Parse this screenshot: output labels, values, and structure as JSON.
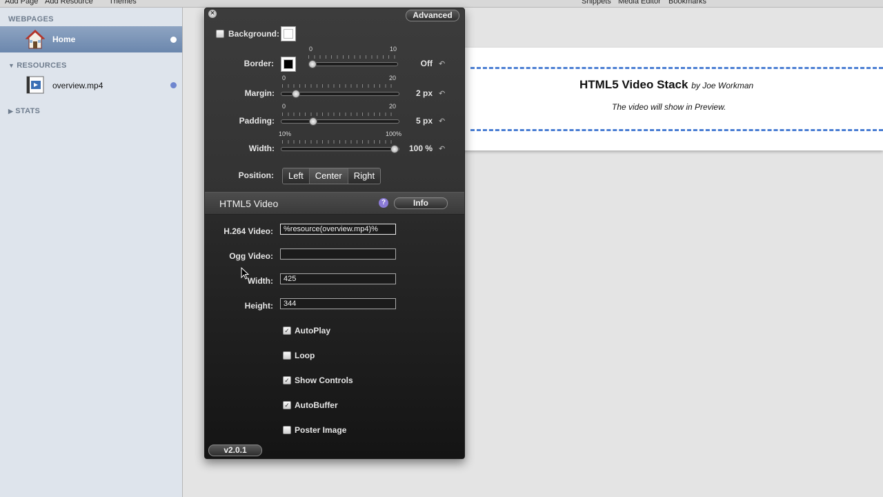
{
  "toolbar": {
    "add_page": "Add Page",
    "add_resource": "Add Resource",
    "themes": "Themes",
    "snippets": "Snippets",
    "media_editor": "Media Editor",
    "bookmarks": "Bookmarks"
  },
  "sidebar": {
    "webpages_header": "WEBPAGES",
    "home_label": "Home",
    "resources_header": "RESOURCES",
    "resource_item": "overview.mp4",
    "stats_header": "STATS"
  },
  "preview": {
    "title": "HTML5 Video Stack",
    "byline": "by Joe Workman",
    "note": "The video will show in Preview."
  },
  "inspector": {
    "advanced_button": "Advanced",
    "background_label": "Background:",
    "border_label": "Border:",
    "border_min": "0",
    "border_max": "10",
    "border_value": "Off",
    "border_level": 0,
    "margin_label": "Margin:",
    "margin_min": "0",
    "margin_max": "20",
    "margin_value": "2 px",
    "margin_level": 2,
    "padding_label": "Padding:",
    "padding_min": "0",
    "padding_max": "20",
    "padding_value": "5 px",
    "padding_level": 5,
    "width_label": "Width:",
    "width_min": "10%",
    "width_max": "100%",
    "width_value": "100 %",
    "width_level": 100,
    "position_label": "Position:",
    "position_left": "Left",
    "position_center": "Center",
    "position_right": "Right",
    "position_selected": "Center",
    "section_title": "HTML5 Video",
    "help_symbol": "?",
    "info_button": "Info",
    "h264_label": "H.264 Video:",
    "h264_value": "%resource(overview.mp4)%",
    "ogg_label": "Ogg Video:",
    "ogg_value": "",
    "video_width_label": "Width:",
    "video_width_value": "425",
    "video_height_label": "Height:",
    "video_height_value": "344",
    "autoplay_label": "AutoPlay",
    "autoplay_checked": true,
    "loop_label": "Loop",
    "loop_checked": false,
    "show_controls_label": "Show Controls",
    "show_controls_checked": true,
    "autobuffer_label": "AutoBuffer",
    "autobuffer_checked": true,
    "poster_label": "Poster Image",
    "poster_checked": false,
    "version": "v2.0.1",
    "reset_symbol": "↶",
    "check_symbol": "✓",
    "close_symbol": "×"
  },
  "colors": {
    "sidebar_bg": "#dee4ec",
    "sidebar_selection": "#7b94b8",
    "panel_bg": "#2f2f2f",
    "dashed_border": "#4a7ed3",
    "status_dot": "#6f86cf"
  },
  "icons": {
    "home_page": "house-icon",
    "video_file": "film-icon",
    "close": "close-icon",
    "help": "help-icon",
    "reset": "reset-arrow-icon"
  }
}
